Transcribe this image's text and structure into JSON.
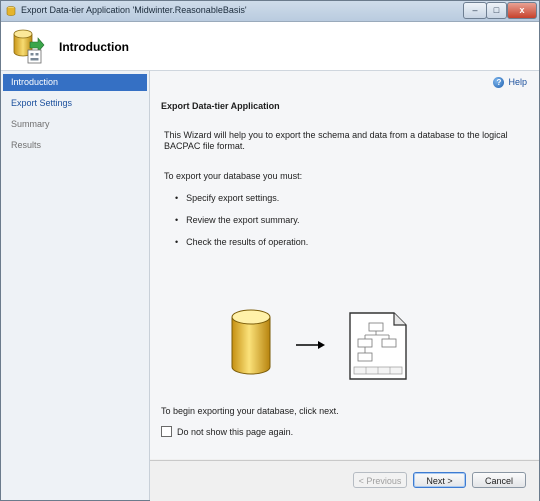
{
  "window": {
    "title": "Export Data-tier Application 'Midwinter.ReasonableBasis'",
    "minimize": "–",
    "maximize": "□",
    "close": "x"
  },
  "header": {
    "title": "Introduction",
    "icon": "database-export-icon"
  },
  "sidebar": {
    "items": [
      {
        "label": "Introduction",
        "state": "active"
      },
      {
        "label": "Export Settings",
        "state": "link"
      },
      {
        "label": "Summary",
        "state": "disabled"
      },
      {
        "label": "Results",
        "state": "disabled"
      }
    ]
  },
  "content": {
    "help_label": "Help",
    "section_title": "Export Data-tier Application",
    "intro": "This Wizard will help you to export the schema and data from a database to the logical BACPAC file format.",
    "steps_intro": "To export your database you must:",
    "steps": [
      "Specify export settings.",
      "Review the export summary.",
      "Check the results of operation."
    ],
    "begin_text": "To begin exporting your database, click next.",
    "checkbox_label": "Do not show this page again.",
    "checkbox_checked": false
  },
  "buttons": {
    "previous": "< Previous",
    "next": "Next >",
    "cancel": "Cancel"
  },
  "colors": {
    "accent": "#3570c4",
    "link": "#1a4f9c"
  }
}
